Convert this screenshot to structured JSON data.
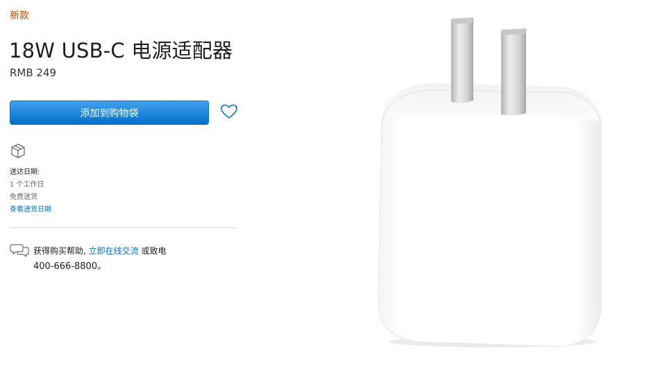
{
  "badge": "新款",
  "product": {
    "title": "18W USB-C 电源适配器",
    "price": "RMB 249"
  },
  "actions": {
    "add_to_bag": "添加到购物袋"
  },
  "delivery": {
    "label": "送达日期:",
    "days": "1 个工作日",
    "free": "免费送货",
    "link": "查看送货日期"
  },
  "help": {
    "prefix": "获得购买帮助, ",
    "chat_link": "立即在线交流",
    "middle": " 或致电",
    "phone": "400-666-8800。"
  },
  "colors": {
    "accent": "#0070c9",
    "badge": "#bf4800"
  }
}
